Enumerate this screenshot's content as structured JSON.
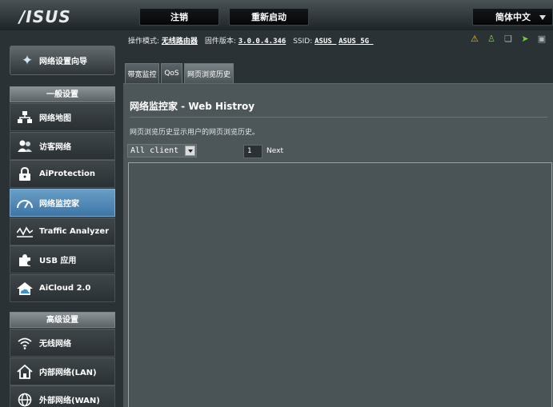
{
  "brand": {
    "logo": "/ISUS"
  },
  "topbar": {
    "logout": "注销",
    "reboot": "重新启动",
    "language": "简体中文"
  },
  "status": {
    "mode_label": "操作模式:",
    "mode_value": "无线路由器",
    "firmware_label": "固件版本:",
    "firmware_value": "3.0.0.4.346",
    "ssid_label": "SSID:",
    "ssid_1": "ASUS_",
    "ssid_2": "ASUS_5G_",
    "icons": [
      "warning-icon",
      "users-icon",
      "printer-icon",
      "usb-icon",
      "app-icon"
    ]
  },
  "sidebar": {
    "qis_label": "网络设置向导",
    "general_header": "一般设置",
    "general_items": [
      {
        "label": "网络地图",
        "icon": "network-map-icon"
      },
      {
        "label": "访客网络",
        "icon": "guest-network-icon"
      },
      {
        "label": "AiProtection",
        "icon": "lock-icon"
      },
      {
        "label": "网络监控家",
        "icon": "gauge-icon"
      },
      {
        "label": "Traffic Analyzer",
        "icon": "traffic-icon"
      },
      {
        "label": "USB 应用",
        "icon": "puzzle-icon"
      },
      {
        "label": "AiCloud 2.0",
        "icon": "cloud-icon"
      }
    ],
    "advanced_header": "高级设置",
    "advanced_items": [
      {
        "label": "无线网络",
        "icon": "wifi-icon"
      },
      {
        "label": "内部网络(LAN)",
        "icon": "home-icon"
      },
      {
        "label": "外部网络(WAN)",
        "icon": "globe-icon"
      }
    ]
  },
  "tabs": [
    "带宽监控",
    "QoS",
    "网页浏览历史"
  ],
  "main": {
    "title": "网络监控家 - Web Histroy",
    "description": "网页浏览历史显示用户的网页浏览历史。",
    "client_select": "All client",
    "page_number": "1",
    "next_label": "Next"
  }
}
